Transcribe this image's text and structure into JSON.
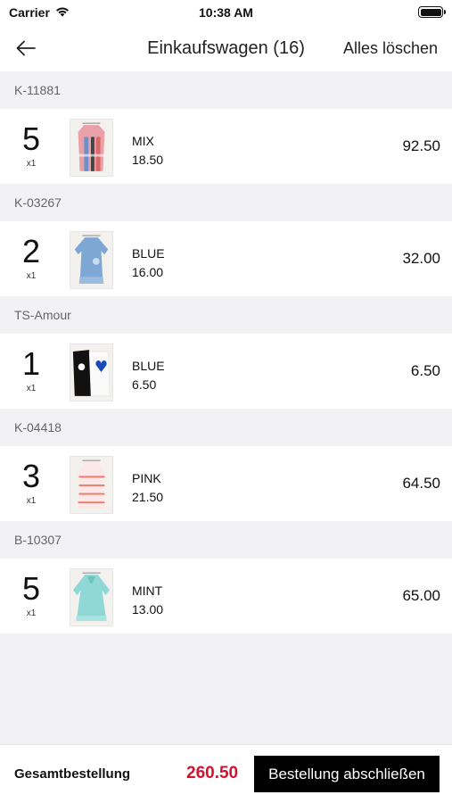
{
  "status_bar": {
    "carrier": "Carrier",
    "time": "10:38 AM"
  },
  "nav": {
    "title": "Einkaufswagen (16)",
    "clear_all": "Alles löschen",
    "back_icon": "arrow-left-icon"
  },
  "items": [
    {
      "sku": "K-11881",
      "qty": "5",
      "mult": "x1",
      "color": "MIX",
      "price": "18.50",
      "total": "92.50"
    },
    {
      "sku": "K-03267",
      "qty": "2",
      "mult": "x1",
      "color": "BLUE",
      "price": "16.00",
      "total": "32.00"
    },
    {
      "sku": "TS-Amour",
      "qty": "1",
      "mult": "x1",
      "color": "BLUE",
      "price": "6.50",
      "total": "6.50"
    },
    {
      "sku": "K-04418",
      "qty": "3",
      "mult": "x1",
      "color": "PINK",
      "price": "21.50",
      "total": "64.50"
    },
    {
      "sku": "B-10307",
      "qty": "5",
      "mult": "x1",
      "color": "MINT",
      "price": "13.00",
      "total": "65.00"
    }
  ],
  "footer": {
    "total_label": "Gesamtbestellung",
    "total_value": "260.50",
    "checkout_label": "Bestellung abschließen"
  },
  "colors": {
    "accent": "#d3122f",
    "button_bg": "#000000",
    "background": "#f2f2f4"
  }
}
